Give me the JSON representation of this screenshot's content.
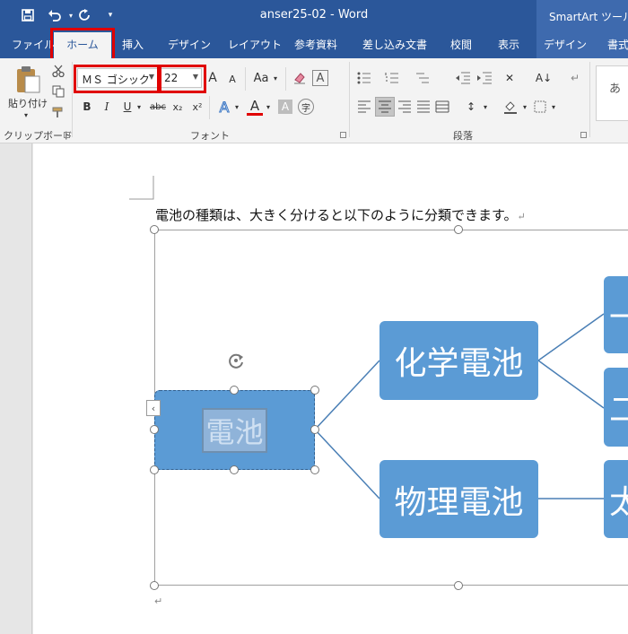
{
  "titlebar": {
    "doc_title": "anser25-02  -  Word",
    "smartart_tools": "SmartArt ツール"
  },
  "tabs": [
    {
      "label": "ファイル"
    },
    {
      "label": "ホーム"
    },
    {
      "label": "挿入"
    },
    {
      "label": "デザイン"
    },
    {
      "label": "レイアウト"
    },
    {
      "label": "参考資料"
    },
    {
      "label": "差し込み文書"
    },
    {
      "label": "校閲"
    },
    {
      "label": "表示"
    },
    {
      "label": "デザイン"
    },
    {
      "label": "書式"
    }
  ],
  "ribbon": {
    "paste_label": "貼り付け",
    "clipboard_label": "クリップボード",
    "font_name": "ＭＳ ゴシック",
    "font_size": "22",
    "font_group_label": "フォント",
    "paragraph_group_label": "段落",
    "style_preview": "あ",
    "change_case": "Aa",
    "bold": "B",
    "italic": "I",
    "underline": "U",
    "strikethrough": "abc",
    "subscript": "x₂",
    "superscript": "x²",
    "grow_font": "A",
    "shrink_font": "A",
    "text_effects": "A",
    "font_color": "A",
    "char_shading": "A",
    "enclose": "字",
    "icon_names": [
      "save-icon",
      "undo-icon",
      "redo-icon",
      "cut-icon",
      "copy-icon",
      "format-painter-icon",
      "clear-format-icon",
      "char-border-icon"
    ]
  },
  "document": {
    "body_text": "電池の種類は、大きく分けると以下のように分類できます。",
    "para_mark": "↵"
  },
  "smartart": {
    "root": "電池",
    "level1": [
      "化学電池",
      "物理電池"
    ],
    "level2": [
      "一",
      "二",
      "太"
    ],
    "colors": {
      "node": "#5b9bd5",
      "connector": "#4a7fb5"
    }
  },
  "colors": {
    "title_bar": "#2b579a",
    "highlight": "#e00000"
  }
}
